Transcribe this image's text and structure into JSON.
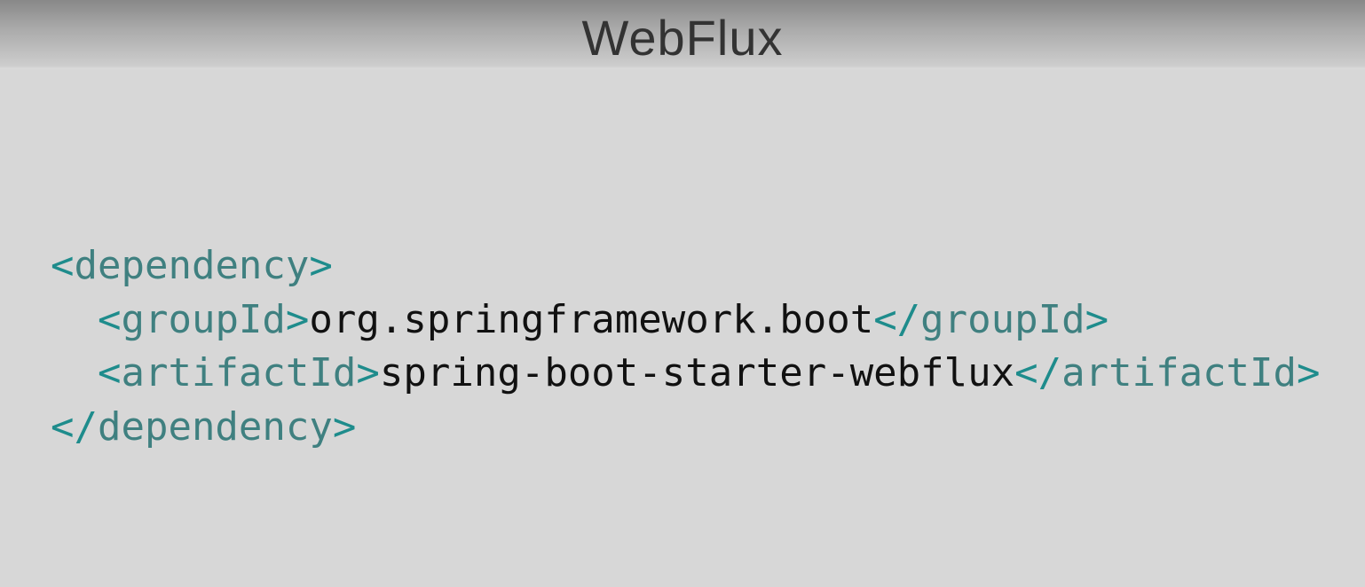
{
  "slide": {
    "title": "WebFlux",
    "code_lines": [
      {
        "indent": "",
        "open": "<dependency>",
        "value": "",
        "close": ""
      },
      {
        "indent": "  ",
        "open": "<groupId>",
        "value": "org.springframework.boot",
        "close": "</groupId>"
      },
      {
        "indent": "  ",
        "open": "<artifactId>",
        "value": "spring-boot-starter-webflux",
        "close": "</artifactId>"
      },
      {
        "indent": "",
        "open": "</dependency>",
        "value": "",
        "close": ""
      }
    ],
    "colors": {
      "tag": "#3f8080",
      "bracket": "#1e8c8c",
      "value": "#111111",
      "background": "#d7d7d7"
    }
  }
}
